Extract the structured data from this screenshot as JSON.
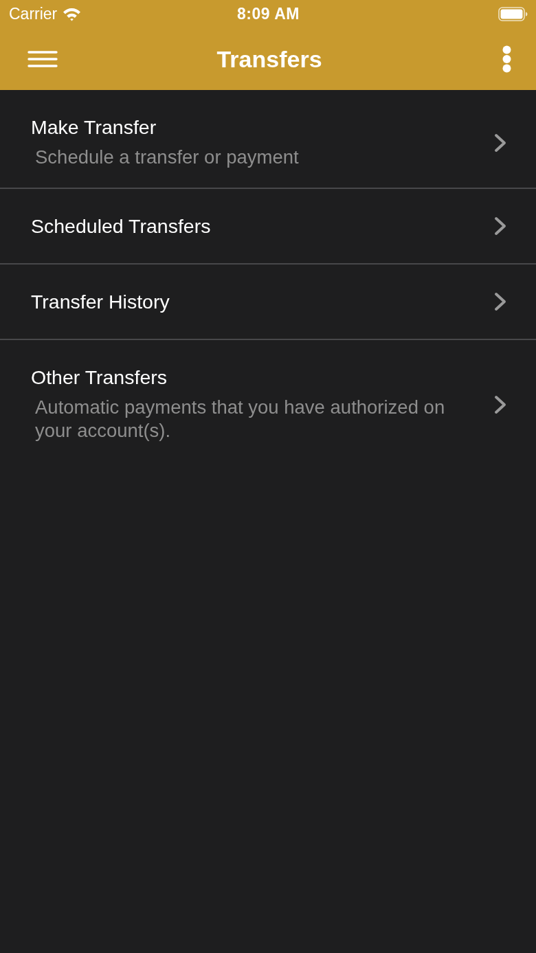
{
  "status_bar": {
    "carrier": "Carrier",
    "time": "8:09 AM"
  },
  "header": {
    "title": "Transfers"
  },
  "menu_items": [
    {
      "title": "Make Transfer",
      "subtitle": "Schedule a transfer or payment"
    },
    {
      "title": "Scheduled Transfers"
    },
    {
      "title": "Transfer History"
    },
    {
      "title": "Other Transfers",
      "subtitle": "Automatic payments that you have authorized on your account(s)."
    }
  ]
}
